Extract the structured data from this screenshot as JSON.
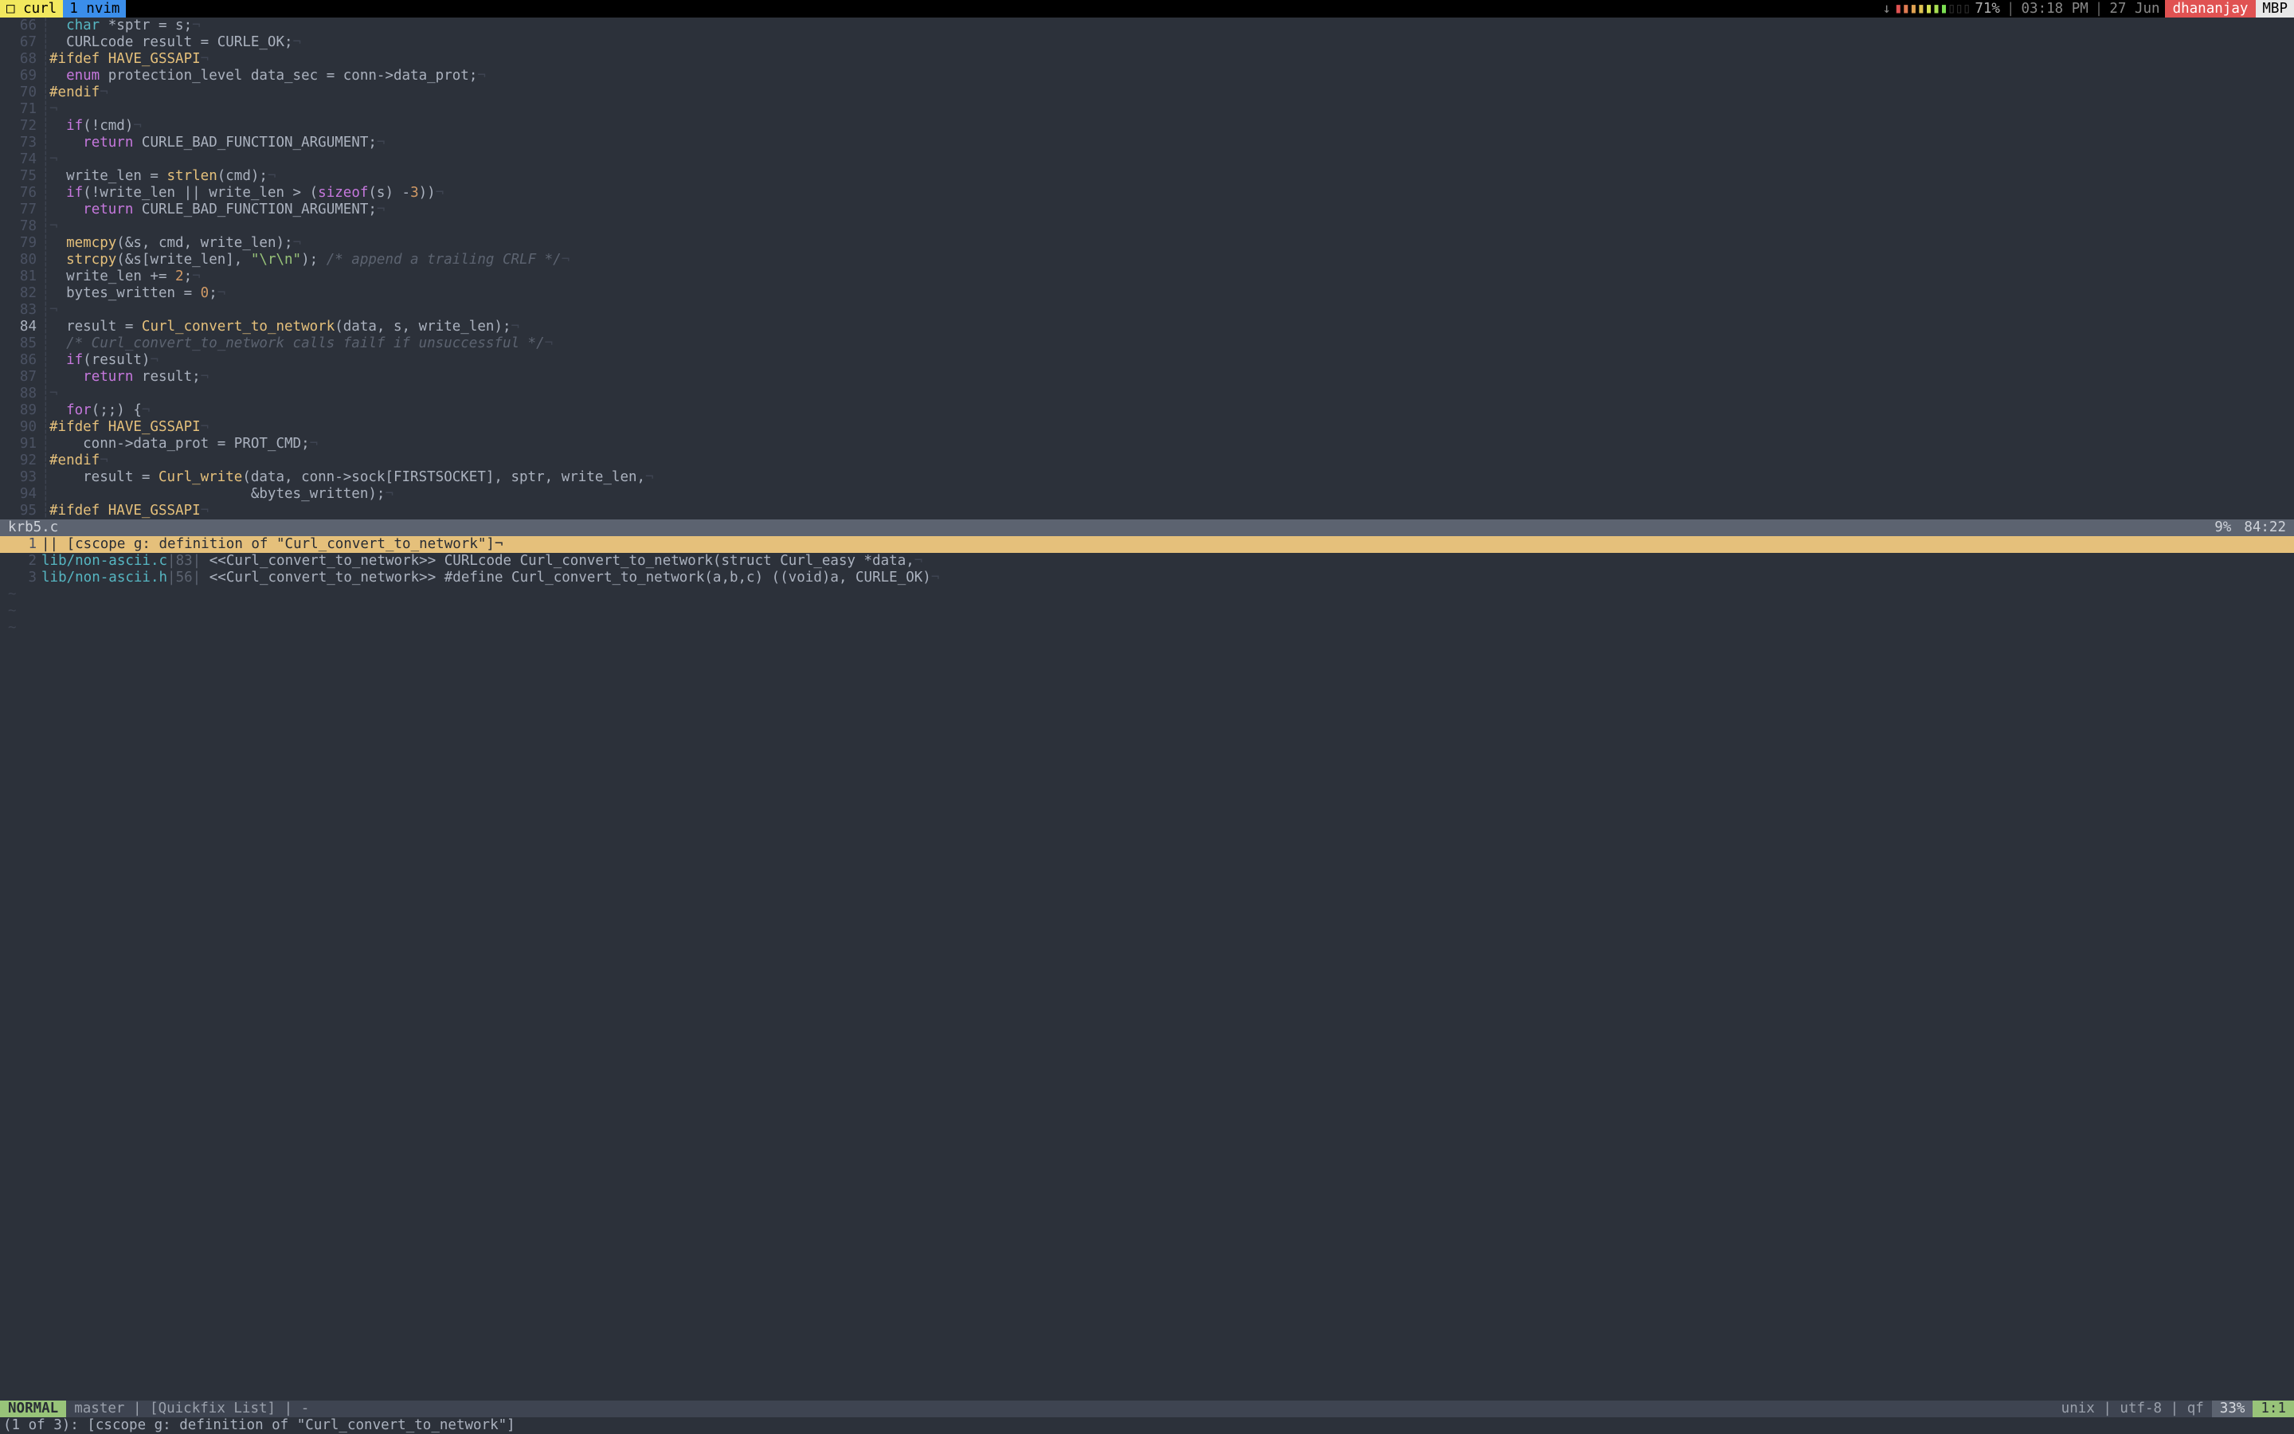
{
  "tmux": {
    "windows": [
      {
        "label": "□ curl",
        "active": true
      },
      {
        "label": "1 nvim",
        "active": false
      }
    ],
    "arrow": "↓",
    "battery_pct": "71%",
    "time": "03:18 PM",
    "date": "27 Jun",
    "user": "dhananjay",
    "host": "MBP",
    "sep": "|"
  },
  "code_lines": [
    {
      "n": "66",
      "html": "  <span class='tok-type'>char</span> *sptr = s;<span class='eol'>¬</span>"
    },
    {
      "n": "67",
      "html": "  CURLcode result = CURLE_OK;<span class='eol'>¬</span>"
    },
    {
      "n": "68",
      "html": "<span class='tok-pre'>#ifdef HAVE_GSSAPI</span><span class='eol'>¬</span>"
    },
    {
      "n": "69",
      "html": "  <span class='tok-kw'>enum</span> protection_level data_sec = conn-&gt;data_prot;<span class='eol'>¬</span>"
    },
    {
      "n": "70",
      "html": "<span class='tok-pre'>#endif</span><span class='eol'>¬</span>"
    },
    {
      "n": "71",
      "html": "<span class='eol'>¬</span>"
    },
    {
      "n": "72",
      "html": "  <span class='tok-kw'>if</span>(!cmd)<span class='eol'>¬</span>"
    },
    {
      "n": "73",
      "html": "    <span class='tok-kw'>return</span> CURLE_BAD_FUNCTION_ARGUMENT;<span class='eol'>¬</span>"
    },
    {
      "n": "74",
      "html": "<span class='eol'>¬</span>"
    },
    {
      "n": "75",
      "html": "  write_len = <span class='tok-fn'>strlen</span>(cmd);<span class='eol'>¬</span>"
    },
    {
      "n": "76",
      "html": "  <span class='tok-kw'>if</span>(!write_len || write_len &gt; (<span class='tok-kw'>sizeof</span>(s) -<span class='tok-num'>3</span>))<span class='eol'>¬</span>"
    },
    {
      "n": "77",
      "html": "    <span class='tok-kw'>return</span> CURLE_BAD_FUNCTION_ARGUMENT;<span class='eol'>¬</span>"
    },
    {
      "n": "78",
      "html": "<span class='eol'>¬</span>"
    },
    {
      "n": "79",
      "html": "  <span class='tok-fn'>memcpy</span>(&amp;s, cmd, write_len);<span class='eol'>¬</span>"
    },
    {
      "n": "80",
      "html": "  <span class='tok-fn'>strcpy</span>(&amp;s[write_len], <span class='tok-str'>\"\\r\\n\"</span>); <span class='tok-cmt'>/* append a trailing CRLF */</span><span class='eol'>¬</span>"
    },
    {
      "n": "81",
      "html": "  write_len += <span class='tok-num'>2</span>;<span class='eol'>¬</span>"
    },
    {
      "n": "82",
      "html": "  bytes_written = <span class='tok-num'>0</span>;<span class='eol'>¬</span>"
    },
    {
      "n": "83",
      "html": "<span class='eol'>¬</span>"
    },
    {
      "n": "84",
      "html": "  result = <span class='tok-fn'>Curl_convert_to_network</span>(data, s, write_len);<span class='eol'>¬</span>",
      "cur": true
    },
    {
      "n": "85",
      "html": "  <span class='tok-cmt'>/* Curl_convert_to_network calls failf if unsuccessful */</span><span class='eol'>¬</span>"
    },
    {
      "n": "86",
      "html": "  <span class='tok-kw'>if</span>(result)<span class='eol'>¬</span>"
    },
    {
      "n": "87",
      "html": "    <span class='tok-kw'>return</span> result;<span class='eol'>¬</span>"
    },
    {
      "n": "88",
      "html": "<span class='eol'>¬</span>"
    },
    {
      "n": "89",
      "html": "  <span class='tok-kw'>for</span>(;;) {<span class='eol'>¬</span>"
    },
    {
      "n": "90",
      "html": "<span class='tok-pre'>#ifdef HAVE_GSSAPI</span><span class='eol'>¬</span>"
    },
    {
      "n": "91",
      "html": "    conn-&gt;data_prot = PROT_CMD;<span class='eol'>¬</span>"
    },
    {
      "n": "92",
      "html": "<span class='tok-pre'>#endif</span><span class='eol'>¬</span>"
    },
    {
      "n": "93",
      "html": "    result = <span class='tok-fn'>Curl_write</span>(data, conn-&gt;sock[FIRSTSOCKET], sptr, write_len,<span class='eol'>¬</span>"
    },
    {
      "n": "94",
      "html": "                        &amp;bytes_written);<span class='eol'>¬</span>"
    },
    {
      "n": "95",
      "html": "<span class='tok-pre'>#ifdef HAVE_GSSAPI</span><span class='eol'>¬</span>"
    }
  ],
  "file_status": {
    "name": "krb5.c",
    "pct": "9%",
    "pos": "84:22"
  },
  "quickfix": [
    {
      "n": "1",
      "sel": true,
      "text": "|| [cscope g: definition of \"Curl_convert_to_network\"]¬"
    },
    {
      "n": "2",
      "sel": false,
      "file": "lib/non-ascii.c",
      "line": "83",
      "rest": " <<Curl_convert_to_network>> CURLcode Curl_convert_to_network(struct Curl_easy *data,",
      "eol": "¬"
    },
    {
      "n": "3",
      "sel": false,
      "file": "lib/non-ascii.h",
      "line": "56",
      "rest": " <<Curl_convert_to_network>> #define Curl_convert_to_network(a,b,c) ((void)a, CURLE_OK)",
      "eol": "¬"
    }
  ],
  "qf_tilde_rows": 3,
  "airline": {
    "mode": "NORMAL",
    "branch": "master | [Quickfix List] | -",
    "enc": "unix | utf-8 | qf",
    "pct": "33%",
    "pos": "1:1"
  },
  "cmdline": "(1 of 3): [cscope g: definition of \"Curl_convert_to_network\"]"
}
